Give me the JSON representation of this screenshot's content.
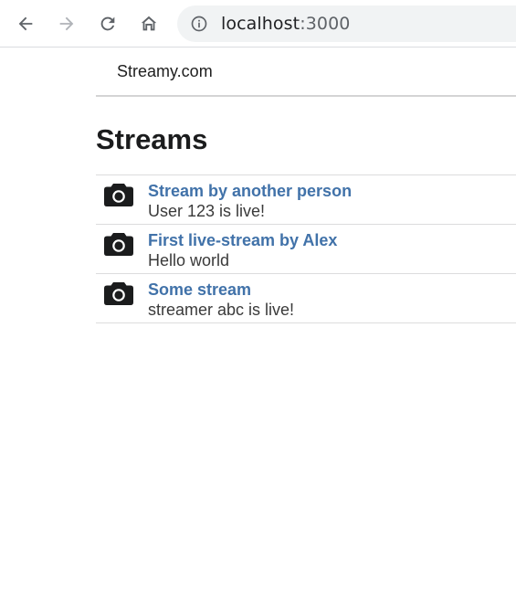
{
  "browser": {
    "url_host": "localhost",
    "url_port": ":3000",
    "icons": [
      "back-arrow-icon",
      "forward-arrow-icon",
      "reload-icon",
      "home-icon",
      "info-icon"
    ]
  },
  "header": {
    "brand": "Streamy.com"
  },
  "page": {
    "title": "Streams"
  },
  "streams": [
    {
      "title": "Stream by another person",
      "description": "User 123 is live!",
      "icon": "camera-icon"
    },
    {
      "title": "First live-stream by Alex",
      "description": "Hello world",
      "icon": "camera-icon"
    },
    {
      "title": "Some stream",
      "description": "streamer abc is live!",
      "icon": "camera-icon"
    }
  ],
  "colors": {
    "link": "#4172a9",
    "divider": "#dcdcdd",
    "omnibox": "#f1f3f4"
  }
}
